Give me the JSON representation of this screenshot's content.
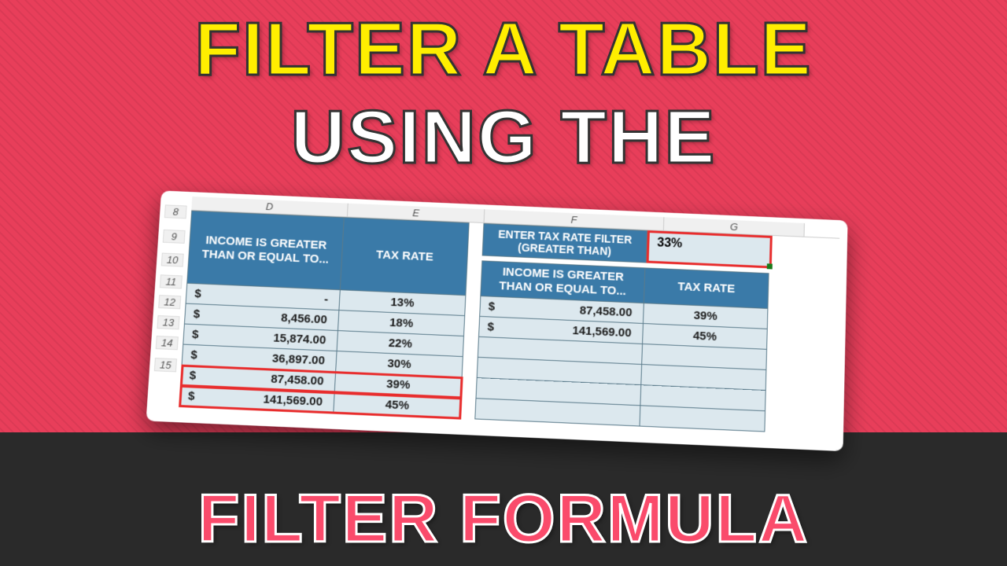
{
  "titles": {
    "line1": "FILTER A TABLE",
    "line2": "USING THE",
    "line3": "FILTER FORMULA"
  },
  "columns": [
    "D",
    "E",
    "F",
    "G"
  ],
  "row_nums": [
    "8",
    "9",
    "10",
    "11",
    "12",
    "13",
    "14",
    "15"
  ],
  "left_table": {
    "header1": "INCOME IS GREATER THAN OR EQUAL TO...",
    "header2": "TAX RATE",
    "rows": [
      {
        "income": "-",
        "rate": "13%"
      },
      {
        "income": "8,456.00",
        "rate": "18%"
      },
      {
        "income": "15,874.00",
        "rate": "22%"
      },
      {
        "income": "36,897.00",
        "rate": "30%"
      },
      {
        "income": "87,458.00",
        "rate": "39%"
      },
      {
        "income": "141,569.00",
        "rate": "45%"
      }
    ]
  },
  "filter": {
    "label": "ENTER TAX RATE FILTER (GREATER THAN)",
    "value": "33%"
  },
  "right_table": {
    "header1": "INCOME IS GREATER THAN OR EQUAL TO...",
    "header2": "TAX RATE",
    "rows": [
      {
        "income": "87,458.00",
        "rate": "39%"
      },
      {
        "income": "141,569.00",
        "rate": "45%"
      }
    ],
    "empty_rows": 4
  },
  "currency_symbol": "$"
}
